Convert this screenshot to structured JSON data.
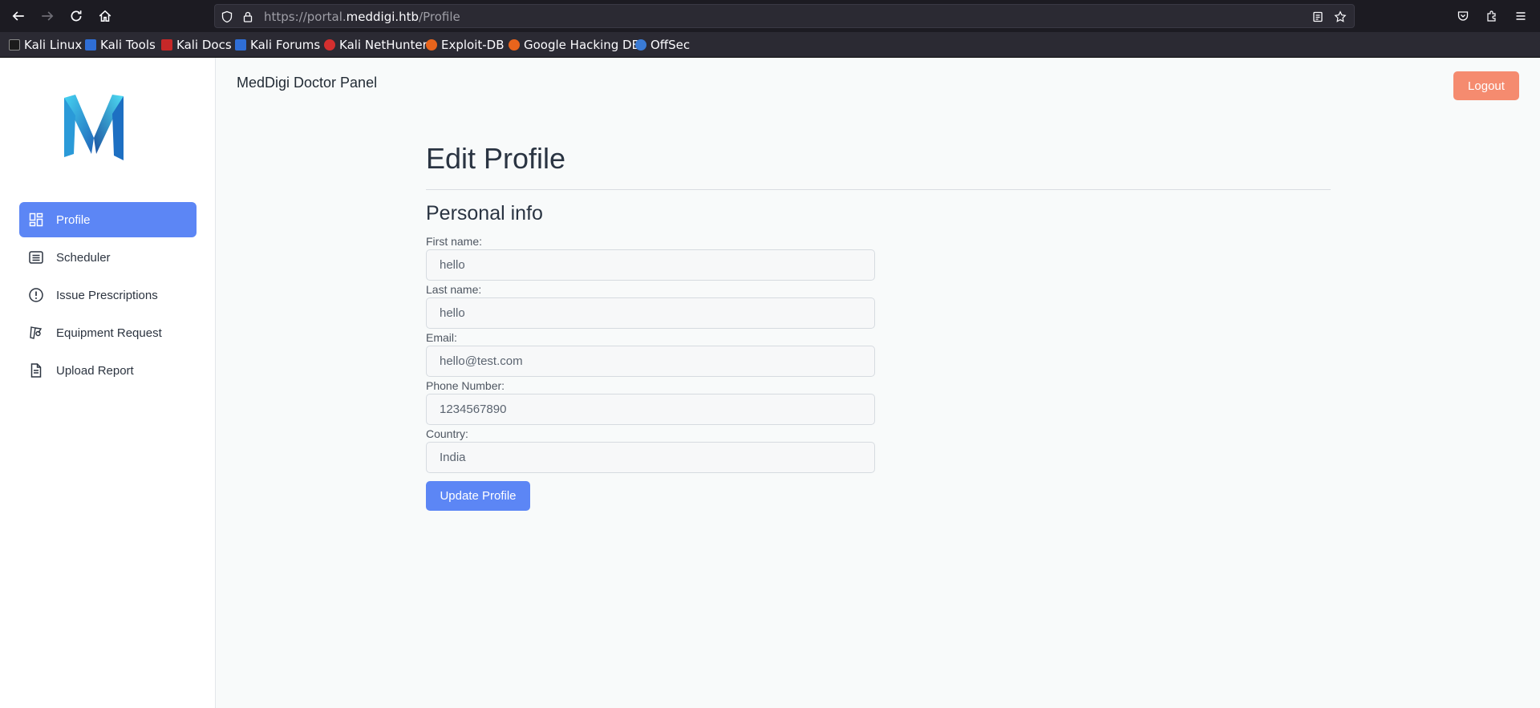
{
  "browser": {
    "url_prefix": "https://portal.",
    "url_domain": "meddigi.htb",
    "url_path": "/Profile",
    "bookmarks": [
      {
        "label": "Kali Linux",
        "color": "#1b1b1b"
      },
      {
        "label": "Kali Tools",
        "color": "#2f6ed6"
      },
      {
        "label": "Kali Docs",
        "color": "#c62828"
      },
      {
        "label": "Kali Forums",
        "color": "#2f6ed6"
      },
      {
        "label": "Kali NetHunter",
        "color": "#d32f2f"
      },
      {
        "label": "Exploit-DB",
        "color": "#e8641c"
      },
      {
        "label": "Google Hacking DB",
        "color": "#e8641c"
      },
      {
        "label": "OffSec",
        "color": "#3a7bd5"
      }
    ]
  },
  "app": {
    "panel_title": "MedDigi Doctor Panel",
    "logout_label": "Logout",
    "accent": "#5c86f5",
    "logout_color": "#f58b6f"
  },
  "sidebar": {
    "items": [
      {
        "label": "Profile",
        "icon": "dashboard-icon",
        "active": true
      },
      {
        "label": "Scheduler",
        "icon": "list-icon",
        "active": false
      },
      {
        "label": "Issue Prescriptions",
        "icon": "alert-circle-icon",
        "active": false
      },
      {
        "label": "Equipment Request",
        "icon": "medal-icon",
        "active": false
      },
      {
        "label": "Upload Report",
        "icon": "file-icon",
        "active": false
      }
    ]
  },
  "main": {
    "heading": "Edit Profile",
    "section": "Personal info",
    "fields": [
      {
        "label": "First name:",
        "value": "hello"
      },
      {
        "label": "Last name:",
        "value": "hello"
      },
      {
        "label": "Email:",
        "value": "hello@test.com"
      },
      {
        "label": "Phone Number:",
        "value": "1234567890"
      },
      {
        "label": "Country:",
        "value": "India"
      }
    ],
    "submit_label": "Update Profile"
  }
}
